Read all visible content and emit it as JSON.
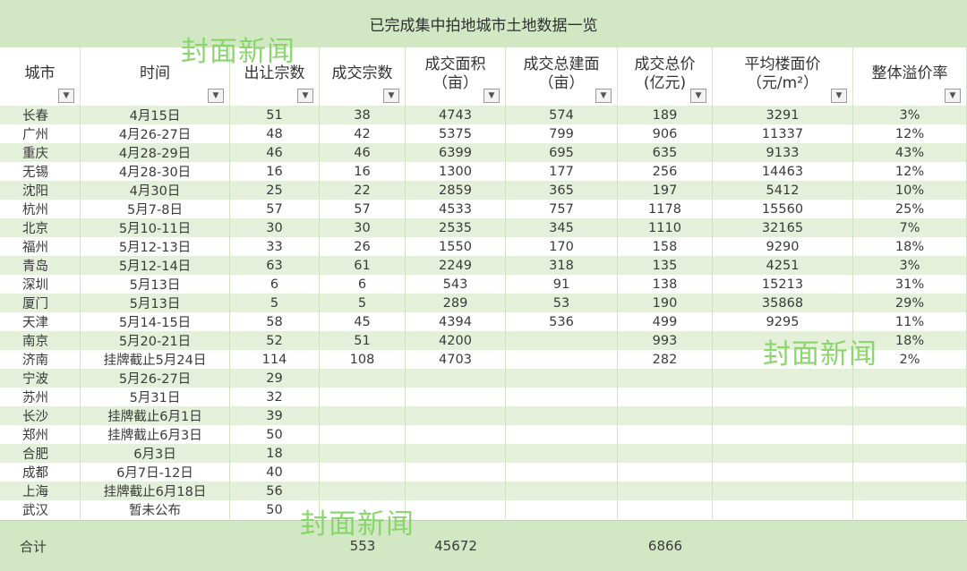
{
  "title": "已完成集中拍地城市土地数据一览",
  "watermark": "封面新闻",
  "columns": [
    {
      "key": "city",
      "lines": [
        "城市"
      ]
    },
    {
      "key": "time",
      "lines": [
        "时间"
      ]
    },
    {
      "key": "offered",
      "lines": [
        "出让宗数"
      ]
    },
    {
      "key": "deals",
      "lines": [
        "成交宗数"
      ]
    },
    {
      "key": "area",
      "lines": [
        "成交面积",
        "（亩）"
      ]
    },
    {
      "key": "build_area",
      "lines": [
        "成交总建面",
        "（亩）"
      ]
    },
    {
      "key": "total_price",
      "lines": [
        "成交总价",
        "(亿元)"
      ]
    },
    {
      "key": "avg_price",
      "lines": [
        "平均楼面价",
        "（元/m²）"
      ]
    },
    {
      "key": "premium",
      "lines": [
        "整体溢价率"
      ]
    }
  ],
  "dropdown_symbol": "▼",
  "rows": [
    [
      "长春",
      "4月15日",
      "51",
      "38",
      "4743",
      "574",
      "189",
      "3291",
      "3%"
    ],
    [
      "广州",
      "4月26-27日",
      "48",
      "42",
      "5375",
      "799",
      "906",
      "11337",
      "12%"
    ],
    [
      "重庆",
      "4月28-29日",
      "46",
      "46",
      "6399",
      "695",
      "635",
      "9133",
      "43%"
    ],
    [
      "无锡",
      "4月28-30日",
      "16",
      "16",
      "1300",
      "177",
      "256",
      "14463",
      "12%"
    ],
    [
      "沈阳",
      "4月30日",
      "25",
      "22",
      "2859",
      "365",
      "197",
      "5412",
      "10%"
    ],
    [
      "杭州",
      "5月7-8日",
      "57",
      "57",
      "4533",
      "757",
      "1178",
      "15560",
      "25%"
    ],
    [
      "北京",
      "5月10-11日",
      "30",
      "30",
      "2535",
      "345",
      "1110",
      "32165",
      "7%"
    ],
    [
      "福州",
      "5月12-13日",
      "33",
      "26",
      "1550",
      "170",
      "158",
      "9290",
      "18%"
    ],
    [
      "青岛",
      "5月12-14日",
      "63",
      "61",
      "2249",
      "318",
      "135",
      "4251",
      "3%"
    ],
    [
      "深圳",
      "5月13日",
      "6",
      "6",
      "543",
      "91",
      "138",
      "15213",
      "31%"
    ],
    [
      "厦门",
      "5月13日",
      "5",
      "5",
      "289",
      "53",
      "190",
      "35868",
      "29%"
    ],
    [
      "天津",
      "5月14-15日",
      "58",
      "45",
      "4394",
      "536",
      "499",
      "9295",
      "11%"
    ],
    [
      "南京",
      "5月20-21日",
      "52",
      "51",
      "4200",
      "",
      "993",
      "",
      "18%"
    ],
    [
      "济南",
      "挂牌截止5月24日",
      "114",
      "108",
      "4703",
      "",
      "282",
      "",
      "2%"
    ],
    [
      "宁波",
      "5月26-27日",
      "29",
      "",
      "",
      "",
      "",
      "",
      ""
    ],
    [
      "苏州",
      "5月31日",
      "32",
      "",
      "",
      "",
      "",
      "",
      ""
    ],
    [
      "长沙",
      "挂牌截止6月1日",
      "39",
      "",
      "",
      "",
      "",
      "",
      ""
    ],
    [
      "郑州",
      "挂牌截止6月3日",
      "50",
      "",
      "",
      "",
      "",
      "",
      ""
    ],
    [
      "合肥",
      "6月3日",
      "18",
      "",
      "",
      "",
      "",
      "",
      ""
    ],
    [
      "成都",
      "6月7日-12日",
      "40",
      "",
      "",
      "",
      "",
      "",
      ""
    ],
    [
      "上海",
      "挂牌截止6月18日",
      "56",
      "",
      "",
      "",
      "",
      "",
      ""
    ],
    [
      "武汉",
      "暂未公布",
      "50",
      "",
      "",
      "",
      "",
      "",
      ""
    ]
  ],
  "footer": {
    "label": "合计",
    "deals_total": "553",
    "area_total": "45672",
    "price_total": "6866"
  }
}
